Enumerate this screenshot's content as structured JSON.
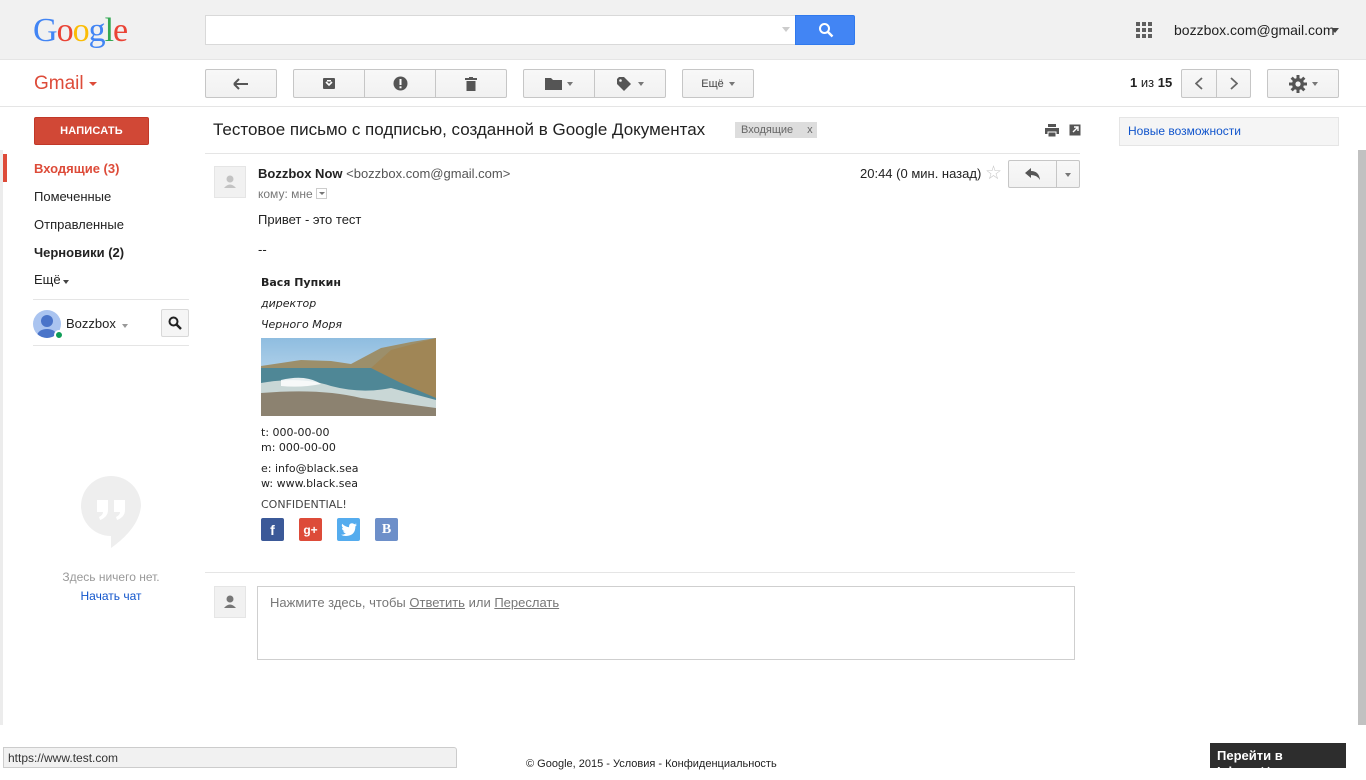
{
  "header": {
    "logo": "Google",
    "logo_colors": [
      "#4285f4",
      "#ea4335",
      "#fbbc05",
      "#4285f4",
      "#34a853",
      "#ea4335"
    ],
    "search_placeholder": "",
    "account_email": "bozzbox.com@gmail.com"
  },
  "toolbar": {
    "app_label": "Gmail",
    "more_label": "Ещё",
    "page_current": "1",
    "page_sep": "из",
    "page_total": "15"
  },
  "sidebar": {
    "compose_label": "НАПИСАТЬ",
    "items": [
      {
        "label": "Входящие (3)",
        "active": true
      },
      {
        "label": "Помеченные"
      },
      {
        "label": "Отправленные"
      },
      {
        "label": "Черновики (2)",
        "bold": true
      },
      {
        "label": "Ещё"
      }
    ],
    "hangouts_user": "Bozzbox",
    "hangouts_empty": "Здесь ничего нет.",
    "start_chat": "Начать чат"
  },
  "message": {
    "subject": "Тестовое письмо с подписью, созданной в Google Документах",
    "label": "Входящие",
    "label_close": "x",
    "sender_name": "Bozzbox Now",
    "sender_email": "<bozzbox.com@gmail.com>",
    "recipients": "кому: мне",
    "time": "20:44 (0 мин. назад)",
    "body_lines": [
      "Привет - это тест",
      "--"
    ],
    "signature": {
      "name": "Вася Пупкин",
      "title": "директор",
      "company": "Черного Моря",
      "phone": " t: 000-00-00",
      "mobile": "m: 000-00-00",
      "email": " e: info@black.sea",
      "web": "w: www.black.sea",
      "confidential": "CONFIDENTIAL!",
      "social": [
        {
          "name": "facebook",
          "glyph": "f",
          "color": "#3b5998"
        },
        {
          "name": "google-plus",
          "glyph": "g+",
          "color": "#dd4b39"
        },
        {
          "name": "twitter",
          "glyph": "t",
          "color": "#55acee"
        },
        {
          "name": "vkontakte",
          "glyph": "B",
          "color": "#6d8fc9"
        }
      ]
    },
    "reply_hint_pre": "Нажмите здесь, чтобы",
    "reply_link": "Ответить",
    "reply_or": "или",
    "forward_link": "Переслать"
  },
  "right_panel": {
    "new_features": "Новые возможности"
  },
  "footer": {
    "status_url": "https://www.test.com",
    "copyright": "© Google, 2015 - Условия - Конфиденциальность",
    "inbox_promo": "Перейти в Inbox",
    "inbox_close": "✕"
  }
}
